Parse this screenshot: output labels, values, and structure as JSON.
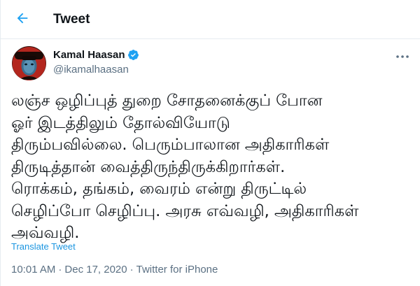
{
  "header": {
    "title": "Tweet",
    "back_icon": "arrow-left-icon",
    "accent_color": "#1da1f2"
  },
  "author": {
    "name": "Kamal Haasan",
    "handle": "@ikamalhaasan",
    "verified": true,
    "verified_icon": "verified-badge-icon",
    "avatar_icon": "profile-avatar"
  },
  "more_icon": "more-options-icon",
  "tweet": {
    "text": "லஞ்ச ஒழிப்புத் துறை சோதனைக்குப் போன\nஓர் இடத்திலும் தோல்வியோடு\nதிரும்பவில்லை. பெரும்பாலான அதிகாரிகள்\nதிருடித்தான் வைத்திருந்திருக்கிறார்கள்.\nரொக்கம், தங்கம், வைரம் என்று திருட்டில்\nசெழிப்போ செழிப்பு. அரசு எவ்வழி, அதிகாரிகள்\nஅவ்வழி.",
    "translate_label": "Translate Tweet",
    "time": "10:01 AM",
    "separator": "·",
    "date": "Dec 17, 2020",
    "source": "Twitter for iPhone"
  }
}
